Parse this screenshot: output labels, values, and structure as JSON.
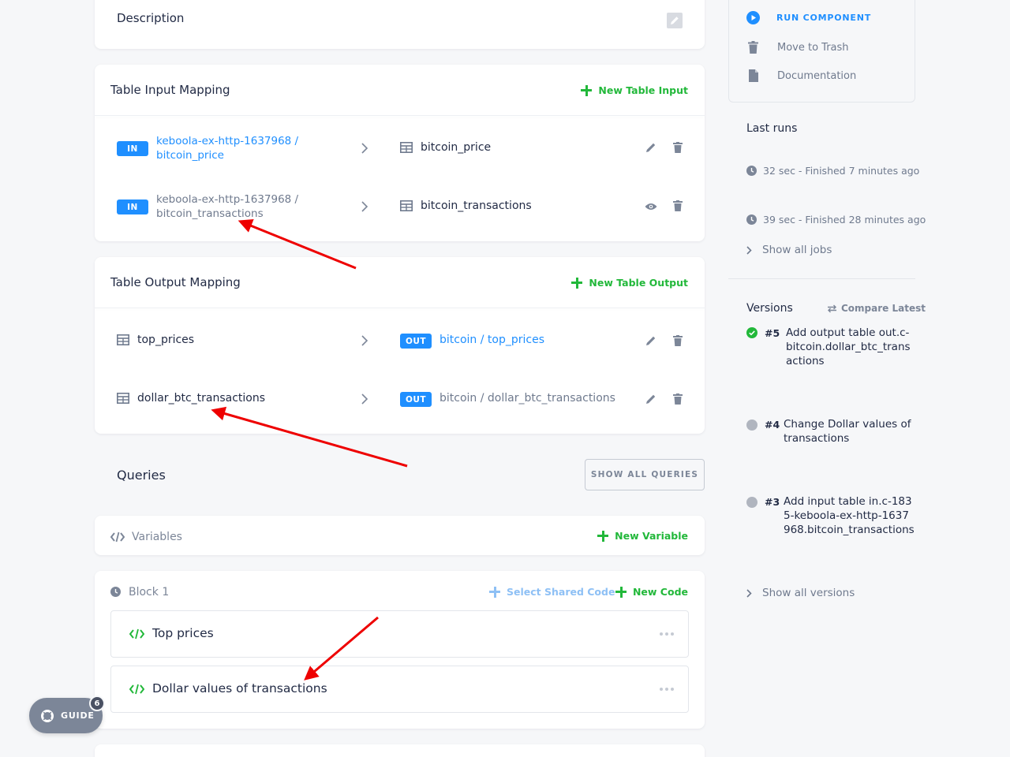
{
  "description_card": {
    "title": "Description"
  },
  "sidebar": {
    "run_label": "RUN COMPONENT",
    "trash_label": "Move to Trash",
    "docs_label": "Documentation",
    "last_runs_title": "Last runs",
    "runs": [
      {
        "text": "32 sec - Finished 7 minutes ago"
      },
      {
        "text": "39 sec - Finished 28 minutes ago"
      }
    ],
    "show_all_jobs": "Show all jobs",
    "versions_title": "Versions",
    "compare_latest": "Compare Latest",
    "versions": [
      {
        "num": "#5",
        "text": "Add output table out.c-bitcoin.dollar_btc_transactions",
        "status": "success"
      },
      {
        "num": "#4",
        "text": "Change Dollar values of transactions",
        "status": "neutral"
      },
      {
        "num": "#3",
        "text": "Add input table in.c-1835-keboola-ex-http-1637968.bitcoin_transactions",
        "status": "neutral"
      }
    ],
    "show_all_versions": "Show all versions"
  },
  "input_mapping": {
    "title": "Table Input Mapping",
    "new_label": "New Table Input",
    "rows": [
      {
        "badge": "IN",
        "source": "keboola-ex-http-1637968 / bitcoin_price",
        "dest": "bitcoin_price"
      },
      {
        "badge": "IN",
        "source": "keboola-ex-http-1637968 / bitcoin_transactions",
        "dest": "bitcoin_transactions"
      }
    ]
  },
  "output_mapping": {
    "title": "Table Output Mapping",
    "new_label": "New Table Output",
    "rows": [
      {
        "source": "top_prices",
        "badge": "OUT",
        "dest": "bitcoin / top_prices"
      },
      {
        "source": "dollar_btc_transactions",
        "badge": "OUT",
        "dest": "bitcoin / dollar_btc_transactions"
      }
    ]
  },
  "queries": {
    "title": "Queries",
    "show_all": "SHOW ALL QUERIES"
  },
  "variables": {
    "title": "Variables",
    "new_label": "New Variable"
  },
  "block": {
    "title": "Block 1",
    "select_shared": "Select Shared Code",
    "new_code": "New Code",
    "codes": [
      {
        "name": "Top prices"
      },
      {
        "name": "Dollar values of transactions"
      }
    ]
  },
  "guide": {
    "label": "GUIDE",
    "count": "6"
  },
  "colors": {
    "accent": "#1f8fff",
    "green": "#22b83a",
    "annotation": "#ee0000"
  }
}
